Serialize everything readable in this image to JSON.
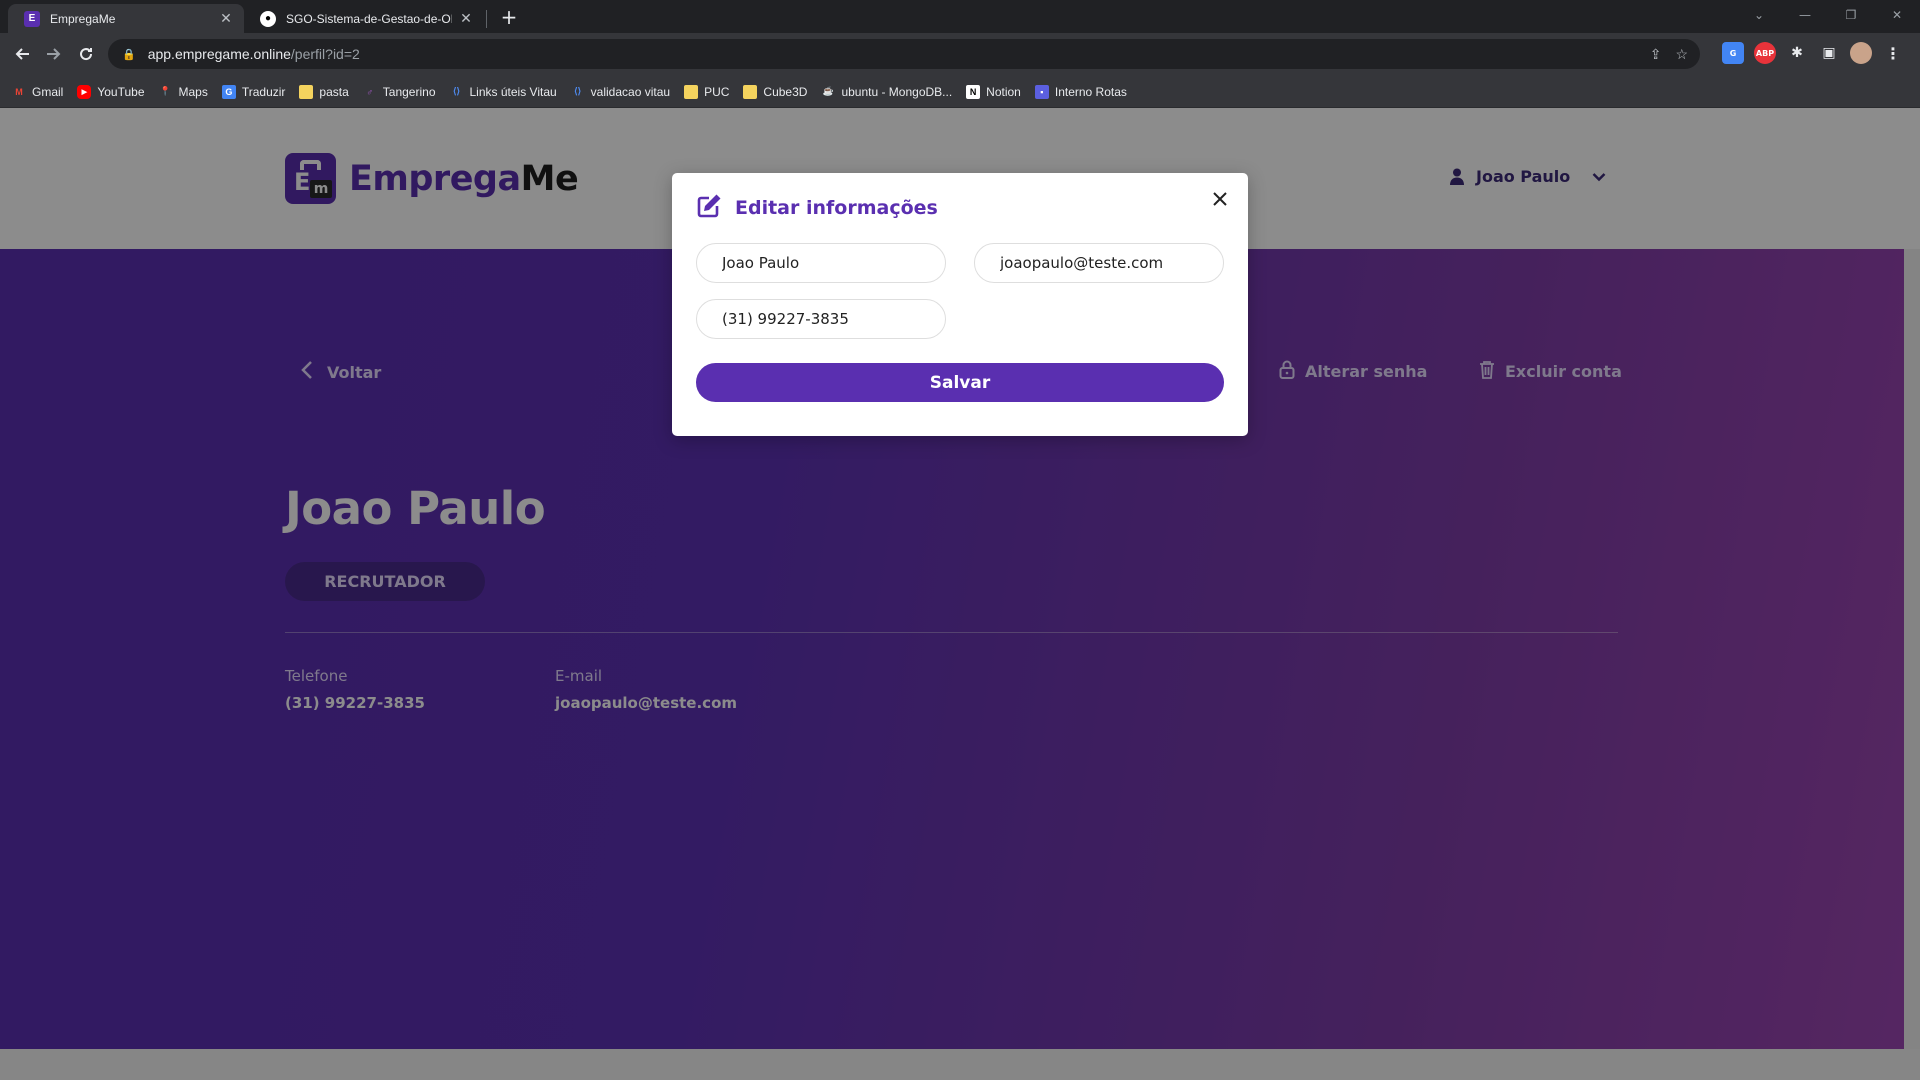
{
  "browser": {
    "tabs": [
      {
        "title": "EmpregaMe",
        "favicon": "emprega-favicon",
        "active": true
      },
      {
        "title": "SGO-Sistema-de-Gestao-de-ON",
        "favicon": "github-favicon",
        "active": false
      }
    ],
    "new_tab": "+",
    "url_host": "app.empregame.online",
    "url_path": "/perfil?id=2",
    "bookmarks": [
      {
        "label": "Gmail",
        "icon": "gmail-icon",
        "color": "#ea4335"
      },
      {
        "label": "YouTube",
        "icon": "youtube-icon",
        "color": "#ff0000"
      },
      {
        "label": "Maps",
        "icon": "maps-icon",
        "color": "#34a853"
      },
      {
        "label": "Traduzir",
        "icon": "translate-icon",
        "color": "#4285f4"
      },
      {
        "label": "pasta",
        "icon": "folder-icon",
        "color": "#f4d35e"
      },
      {
        "label": "Tangerino",
        "icon": "tangerino-icon",
        "color": "#b05bd6"
      },
      {
        "label": "Links úteis Vitau",
        "icon": "vitau-icon",
        "color": "#4f8df5"
      },
      {
        "label": "validacao vitau",
        "icon": "vitau-icon",
        "color": "#4f8df5"
      },
      {
        "label": "PUC",
        "icon": "folder-icon",
        "color": "#f4d35e"
      },
      {
        "label": "Cube3D",
        "icon": "folder-icon",
        "color": "#f4d35e"
      },
      {
        "label": "ubuntu - MongoDB...",
        "icon": "java-icon",
        "color": "#e76f00"
      },
      {
        "label": "Notion",
        "icon": "notion-icon",
        "color": "#ffffff"
      },
      {
        "label": "Interno Rotas",
        "icon": "rotas-icon",
        "color": "#5b5fe0"
      }
    ]
  },
  "site": {
    "logo_part1": "Emprega",
    "logo_part2": "Me",
    "user_name": "Joao Paulo",
    "back_label": "Voltar",
    "change_password_label": "Alterar senha",
    "delete_account_label": "Excluir conta",
    "profile_name": "Joao Paulo",
    "role": "RECRUTADOR",
    "phone_label": "Telefone",
    "phone_value": "(31) 99227-3835",
    "email_label": "E-mail",
    "email_value": "joaopaulo@teste.com"
  },
  "modal": {
    "title": "Editar informações",
    "name_value": "Joao Paulo",
    "email_value": "joaopaulo@teste.com",
    "phone_value": "(31) 99227-3835",
    "save_label": "Salvar"
  },
  "colors": {
    "brand": "#5a2fb0",
    "brand_dark": "#1e1e1e"
  }
}
